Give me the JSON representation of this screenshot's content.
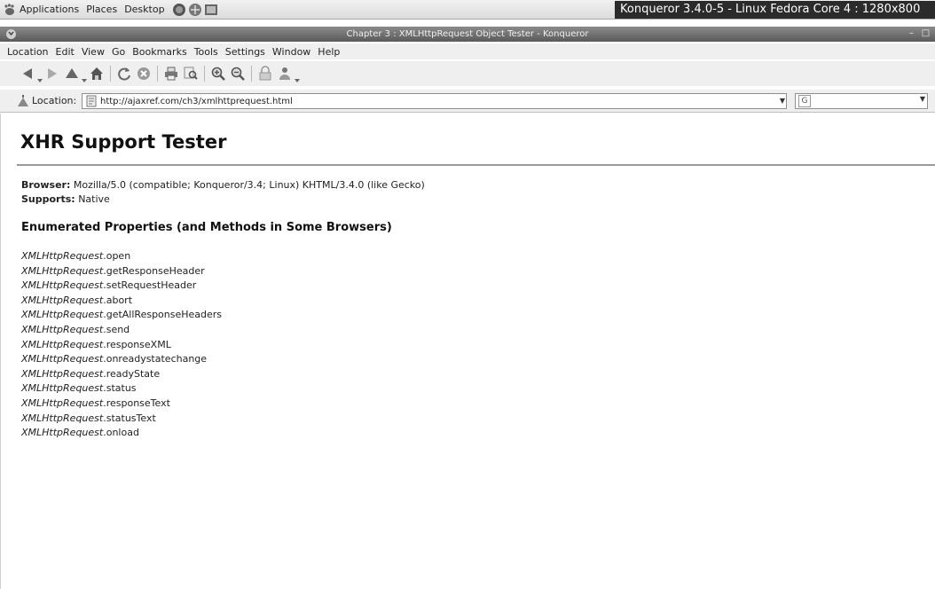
{
  "panel": {
    "menus": [
      "Applications",
      "Places",
      "Desktop"
    ],
    "title": "Konqueror 3.4.0-5 - Linux Fedora Core 4 : 1280x800"
  },
  "window": {
    "title": "Chapter 3 : XMLHttpRequest Object Tester - Konqueror"
  },
  "menubar": [
    "Location",
    "Edit",
    "View",
    "Go",
    "Bookmarks",
    "Tools",
    "Settings",
    "Window",
    "Help"
  ],
  "locationbar": {
    "label": "Location:",
    "url": "http://ajaxref.com/ch3/xmlhttprequest.html"
  },
  "page": {
    "title": "XHR Support Tester",
    "browser_label": "Browser:",
    "browser_value": " Mozilla/5.0 (compatible; Konqueror/3.4; Linux) KHTML/3.4.0 (like Gecko)",
    "supports_label": "Supports:",
    "supports_value": " Native",
    "section_heading": "Enumerated Properties (and Methods in Some Browsers)",
    "object_name": "XMLHttpRequest",
    "properties": [
      ".open",
      ".getResponseHeader",
      ".setRequestHeader",
      ".abort",
      ".getAllResponseHeaders",
      ".send",
      ".responseXML",
      ".onreadystatechange",
      ".readyState",
      ".status",
      ".responseText",
      ".statusText",
      ".onload"
    ]
  },
  "colors": {
    "panel_title_bg": "#2b2b2b",
    "titlebar_bg": "#6e6e6e",
    "chrome_bg": "#efefef"
  }
}
